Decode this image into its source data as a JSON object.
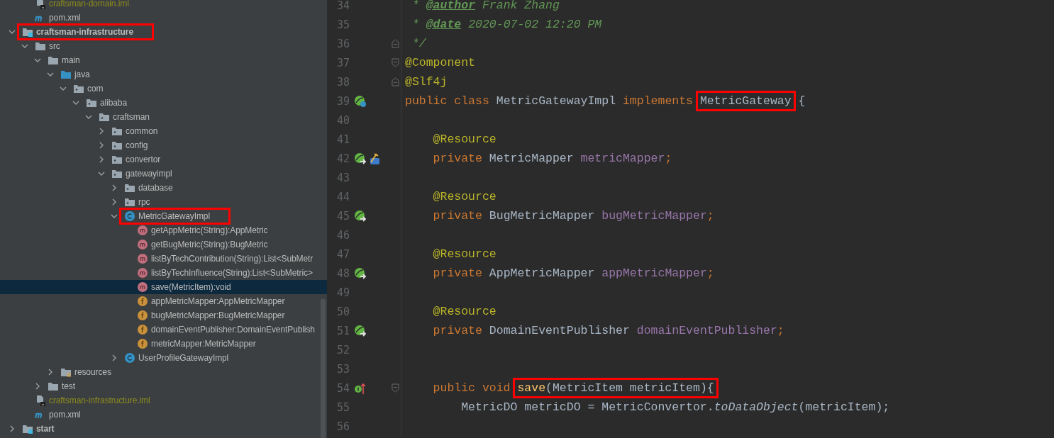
{
  "project_tree": {
    "partial_items": [
      {
        "label": "craftsman-domain.iml",
        "kind": "iml"
      },
      {
        "label": "pom.xml",
        "kind": "maven"
      }
    ],
    "items": [
      {
        "label": "craftsman-infrastructure",
        "kind": "module",
        "expanded": true,
        "selected": false,
        "highlighted": true,
        "children": [
          {
            "label": "src",
            "kind": "folder",
            "expanded": true,
            "selected": false,
            "children": [
              {
                "label": "main",
                "kind": "folder",
                "expanded": true,
                "selected": false,
                "children": [
                  {
                    "label": "java",
                    "kind": "source-folder",
                    "expanded": true,
                    "selected": false,
                    "children": [
                      {
                        "label": "com",
                        "kind": "package",
                        "expanded": true,
                        "selected": false,
                        "children": [
                          {
                            "label": "alibaba",
                            "kind": "package",
                            "expanded": true,
                            "selected": false,
                            "children": [
                              {
                                "label": "craftsman",
                                "kind": "package",
                                "expanded": true,
                                "selected": false,
                                "children": [
                                  {
                                    "label": "common",
                                    "kind": "package",
                                    "expanded": false,
                                    "selected": false
                                  },
                                  {
                                    "label": "config",
                                    "kind": "package",
                                    "expanded": false,
                                    "selected": false
                                  },
                                  {
                                    "label": "convertor",
                                    "kind": "package",
                                    "expanded": false,
                                    "selected": false
                                  },
                                  {
                                    "label": "gatewayimpl",
                                    "kind": "package",
                                    "expanded": true,
                                    "selected": false,
                                    "children": [
                                      {
                                        "label": "database",
                                        "kind": "package",
                                        "expanded": false,
                                        "selected": false
                                      },
                                      {
                                        "label": "rpc",
                                        "kind": "package",
                                        "expanded": false,
                                        "selected": false
                                      },
                                      {
                                        "label": "MetricGatewayImpl",
                                        "kind": "class",
                                        "expanded": true,
                                        "selected": false,
                                        "highlighted": true,
                                        "children": [
                                          {
                                            "label": "getAppMetric(String):AppMetric",
                                            "kind": "method",
                                            "selected": false
                                          },
                                          {
                                            "label": "getBugMetric(String):BugMetric",
                                            "kind": "method",
                                            "selected": false
                                          },
                                          {
                                            "label": "listByTechContribution(String):List<SubMetr",
                                            "kind": "method",
                                            "selected": false
                                          },
                                          {
                                            "label": "listByTechInfluence(String):List<SubMetric>",
                                            "kind": "method",
                                            "selected": false
                                          },
                                          {
                                            "label": "save(MetricItem):void",
                                            "kind": "method",
                                            "selected": true
                                          },
                                          {
                                            "label": "appMetricMapper:AppMetricMapper",
                                            "kind": "field",
                                            "selected": false
                                          },
                                          {
                                            "label": "bugMetricMapper:BugMetricMapper",
                                            "kind": "field",
                                            "selected": false
                                          },
                                          {
                                            "label": "domainEventPublisher:DomainEventPublish",
                                            "kind": "field",
                                            "selected": false
                                          },
                                          {
                                            "label": "metricMapper:MetricMapper",
                                            "kind": "field",
                                            "selected": false
                                          }
                                        ]
                                      },
                                      {
                                        "label": "UserProfileGatewayImpl",
                                        "kind": "class",
                                        "expanded": false,
                                        "selected": false
                                      }
                                    ]
                                  }
                                ]
                              }
                            ]
                          }
                        ]
                      }
                    ]
                  },
                  {
                    "label": "resources",
                    "kind": "resources-folder",
                    "expanded": false,
                    "selected": false
                  }
                ]
              },
              {
                "label": "test",
                "kind": "folder",
                "expanded": false,
                "selected": false
              }
            ]
          },
          {
            "label": "craftsman-infrastructure.iml",
            "kind": "iml",
            "selected": false
          },
          {
            "label": "pom.xml",
            "kind": "maven",
            "selected": false
          }
        ]
      },
      {
        "label": "start",
        "kind": "module",
        "expanded": false,
        "selected": false
      }
    ]
  },
  "editor": {
    "lines": [
      {
        "number": "34",
        "tokens": [
          {
            "kind": "comment",
            "text": " * "
          },
          {
            "kind": "doc-tag",
            "text": "@author"
          },
          {
            "kind": "comment",
            "text": " Frank Zhang"
          }
        ]
      },
      {
        "number": "35",
        "tokens": [
          {
            "kind": "comment",
            "text": " * "
          },
          {
            "kind": "doc-tag",
            "text": "@date"
          },
          {
            "kind": "comment",
            "text": " 2020-07-02 12:20 PM"
          }
        ]
      },
      {
        "number": "36",
        "fold": {
          "kind": "end"
        },
        "tokens": [
          {
            "kind": "comment",
            "text": " */"
          }
        ]
      },
      {
        "number": "37",
        "fold": {
          "kind": "start"
        },
        "tokens": [
          {
            "kind": "annotation",
            "text": "@Component"
          }
        ]
      },
      {
        "number": "38",
        "fold": {
          "kind": "end"
        },
        "tokens": [
          {
            "kind": "annotation",
            "text": "@Slf4j"
          }
        ]
      },
      {
        "number": "39",
        "markers": [
          {
            "kind": "bean-class"
          }
        ],
        "tokens": [
          {
            "kind": "keyword",
            "text": "public class "
          },
          {
            "kind": "plain",
            "text": "MetricGatewayImpl "
          },
          {
            "kind": "keyword",
            "text": "implements "
          },
          {
            "kind": "box",
            "tokens": [
              {
                "kind": "plain",
                "text": "MetricGateway"
              }
            ]
          },
          {
            "kind": "plain",
            "text": " {"
          }
        ]
      },
      {
        "number": "40"
      },
      {
        "number": "41",
        "tokens": [
          {
            "kind": "annotation",
            "text": "    @Resource"
          }
        ]
      },
      {
        "number": "42",
        "markers": [
          {
            "kind": "bean-injected"
          },
          {
            "kind": "hammer"
          }
        ],
        "tokens": [
          {
            "kind": "keyword",
            "text": "    private "
          },
          {
            "kind": "plain",
            "text": "MetricMapper "
          },
          {
            "kind": "field",
            "text": "metricMapper"
          },
          {
            "kind": "keyword",
            "text": ";"
          }
        ]
      },
      {
        "number": "43"
      },
      {
        "number": "44",
        "tokens": [
          {
            "kind": "annotation",
            "text": "    @Resource"
          }
        ]
      },
      {
        "number": "45",
        "markers": [
          {
            "kind": "bean-injected"
          }
        ],
        "tokens": [
          {
            "kind": "keyword",
            "text": "    private "
          },
          {
            "kind": "plain",
            "text": "BugMetricMapper "
          },
          {
            "kind": "field",
            "text": "bugMetricMapper"
          },
          {
            "kind": "keyword",
            "text": ";"
          }
        ]
      },
      {
        "number": "46"
      },
      {
        "number": "47",
        "tokens": [
          {
            "kind": "annotation",
            "text": "    @Resource"
          }
        ]
      },
      {
        "number": "48",
        "markers": [
          {
            "kind": "bean-injected"
          }
        ],
        "tokens": [
          {
            "kind": "keyword",
            "text": "    private "
          },
          {
            "kind": "plain",
            "text": "AppMetricMapper "
          },
          {
            "kind": "field",
            "text": "appMetricMapper"
          },
          {
            "kind": "keyword",
            "text": ";"
          }
        ]
      },
      {
        "number": "49"
      },
      {
        "number": "50",
        "tokens": [
          {
            "kind": "annotation",
            "text": "    @Resource"
          }
        ]
      },
      {
        "number": "51",
        "markers": [
          {
            "kind": "bean-injected"
          }
        ],
        "tokens": [
          {
            "kind": "keyword",
            "text": "    private "
          },
          {
            "kind": "plain",
            "text": "DomainEventPublisher "
          },
          {
            "kind": "field",
            "text": "domainEventPublisher"
          },
          {
            "kind": "keyword",
            "text": ";"
          }
        ]
      },
      {
        "number": "52"
      },
      {
        "number": "53"
      },
      {
        "number": "54",
        "markers": [
          {
            "kind": "implements-up"
          }
        ],
        "fold": {
          "kind": "start"
        },
        "tokens": [
          {
            "kind": "keyword",
            "text": "    public void "
          },
          {
            "kind": "box",
            "tokens": [
              {
                "kind": "method",
                "text": "save"
              },
              {
                "kind": "plain",
                "text": "(MetricItem metricItem){"
              }
            ]
          }
        ]
      },
      {
        "number": "55",
        "tokens": [
          {
            "kind": "plain",
            "text": "        MetricDO metricDO = MetricConvertor."
          },
          {
            "kind": "static",
            "text": "toDataObject"
          },
          {
            "kind": "plain",
            "text": "(metricItem);"
          }
        ]
      },
      {
        "number": "56"
      }
    ]
  }
}
